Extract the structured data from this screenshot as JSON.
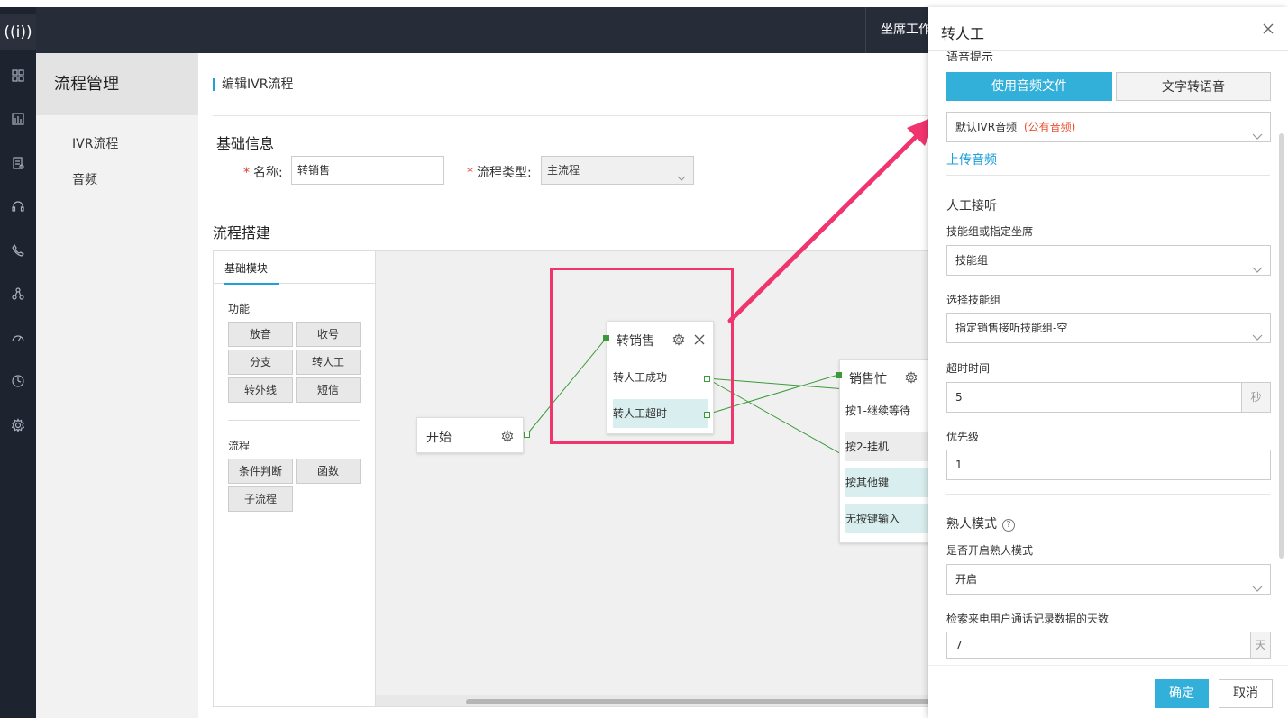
{
  "app": {
    "logo": "((i))"
  },
  "rail_icons": [
    "grid-icon",
    "bar-chart-icon",
    "report-icon",
    "headset-icon",
    "phone-icon",
    "flow-icon",
    "gauge-icon",
    "clock-icon",
    "gear-icon"
  ],
  "topbar": {
    "right_tab": "坐席工作台"
  },
  "sidebar": {
    "title": "流程管理",
    "items": [
      {
        "label": "IVR流程"
      },
      {
        "label": "音频"
      }
    ]
  },
  "content": {
    "breadcrumb": "编辑IVR流程",
    "basic_title": "基础信息",
    "name_label": "名称:",
    "name_value": "转销售",
    "type_label": "流程类型:",
    "type_value": "主流程",
    "build_title": "流程搭建"
  },
  "palette": {
    "tab": "基础模块",
    "function_title": "功能",
    "function_buttons": [
      "放音",
      "收号",
      "分支",
      "转人工",
      "转外线",
      "短信"
    ],
    "flow_title": "流程",
    "flow_buttons": [
      "条件判断",
      "函数",
      "子流程"
    ]
  },
  "canvas": {
    "start": {
      "title": "开始"
    },
    "transfer": {
      "title": "转销售",
      "rows": [
        "转人工成功",
        "转人工超时"
      ]
    },
    "busy": {
      "title": "销售忙",
      "rows": [
        "按1-继续等待",
        "按2-挂机",
        "按其他键",
        "无按键输入"
      ]
    }
  },
  "panel": {
    "title": "转人工",
    "voice_section": "语音提示",
    "seg_audio": "使用音频文件",
    "seg_tts": "文字转语音",
    "audio_select_value": "默认IVR音频",
    "audio_select_tag": "(公有音频)",
    "upload_link": "上传音频",
    "agent_section": "人工接听",
    "skill_or_agent_label": "技能组或指定坐席",
    "skill_or_agent_value": "技能组",
    "choose_skill_label": "选择技能组",
    "choose_skill_value": "指定销售接听技能组-空",
    "timeout_label": "超时时间",
    "timeout_value": "5",
    "timeout_unit": "秒",
    "priority_label": "优先级",
    "priority_value": "1",
    "familiar_section": "熟人模式",
    "familiar_help": "?",
    "familiar_enable_label": "是否开启熟人模式",
    "familiar_enable_value": "开启",
    "days_label": "检索来电用户通话记录数据的天数",
    "days_value": "7",
    "days_unit": "天",
    "ok": "确定",
    "cancel": "取消"
  },
  "colors": {
    "accent": "#33b0d9",
    "highlight": "#f0346e",
    "connector": "#3a9a3a",
    "rail": "#1e2330",
    "topbar": "#262c38"
  }
}
